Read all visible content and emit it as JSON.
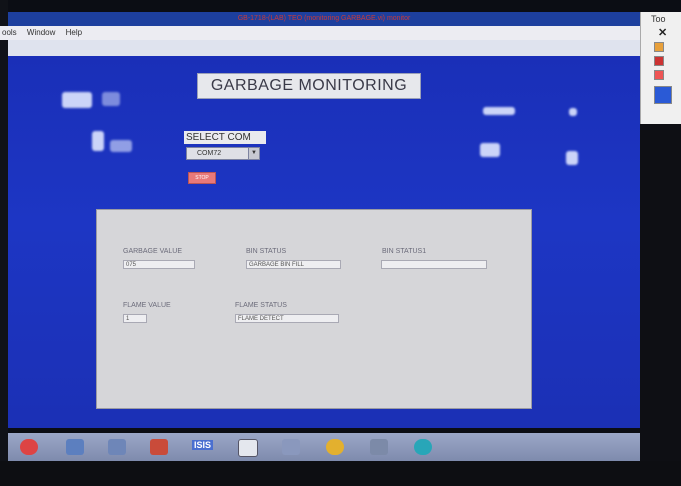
{
  "window": {
    "title": "GB-1718-(LAB) TEO (monitoring GARBAGE.vi) monitor"
  },
  "menubar": {
    "items": [
      "ools",
      "Window",
      "Help"
    ]
  },
  "front_panel": {
    "title": "GARBAGE MONITORING",
    "select_com_label": "SELECT COM",
    "com_port_value": "COM72",
    "stop_button_label": "STOP"
  },
  "indicators": {
    "garbage_value_label": "GARBAGE VALUE",
    "garbage_value": "075",
    "bin_status_label": "BIN STATUS",
    "bin_status": "GARBAGE BIN FILL",
    "bin_status1_label": "BIN STATUS1",
    "bin_status1": "",
    "flame_value_label": "FLAME VALUE",
    "flame_value": "1",
    "flame_status_label": "FLAME STATUS",
    "flame_status": "FLAME DETECT"
  },
  "tools_palette": {
    "title": "Too"
  },
  "taskbar": {
    "isis_label": "ISIS"
  },
  "colors": {
    "panel_blue": "#1d36c4",
    "front_panel_gray": "#d6d6d9",
    "stop_red": "#e8797a"
  }
}
